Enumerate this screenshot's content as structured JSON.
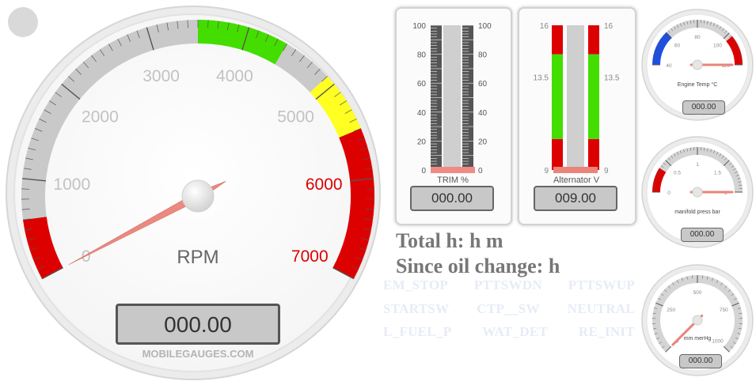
{
  "colors": {
    "red": "#dd0000",
    "yellow": "#ffff22",
    "green": "#44dd00",
    "blue": "#1e4fe0",
    "needle": "#e9847a",
    "lcd_bg": "#c8c8c8"
  },
  "tach": {
    "ticks": [
      "0",
      "1000",
      "2000",
      "3000",
      "4000",
      "5000",
      "6000",
      "7000"
    ],
    "label": "RPM",
    "readout": "000.00",
    "brand": "MOBILEGAUGES.COM",
    "value": 0
  },
  "trim": {
    "scale": [
      "100",
      "80",
      "60",
      "40",
      "20",
      "0"
    ],
    "label": "TRIM %",
    "readout": "000.00",
    "value": 0
  },
  "alternator": {
    "scale": [
      "16",
      "13.5",
      "9"
    ],
    "label": "Alternator V",
    "readout": "009.00",
    "value": 9
  },
  "engine_temp": {
    "ticks": [
      "40",
      "60",
      "80",
      "100",
      "120"
    ],
    "label": "Engine Temp °C",
    "readout": "000.00"
  },
  "manifold": {
    "ticks": [
      "0",
      "0.5",
      "1",
      "1.5",
      "2"
    ],
    "label": "manifold press bar",
    "readout": "000.00"
  },
  "vacuum": {
    "ticks": [
      "0",
      "250",
      "500",
      "750",
      "1000"
    ],
    "label": "mm merHg",
    "readout": "000.00"
  },
  "info": {
    "total_hours": "Total h: h m",
    "oil_change": "Since oil change: h"
  },
  "status": {
    "row1": [
      "EM_STOP",
      "PTTSWDN",
      "PTTSWUP"
    ],
    "row2": [
      "STARTSW",
      "CTP__SW",
      "NEUTRAL"
    ],
    "row3": [
      "L_FUEL_P",
      "WAT_DET",
      "RE_INIT"
    ]
  }
}
